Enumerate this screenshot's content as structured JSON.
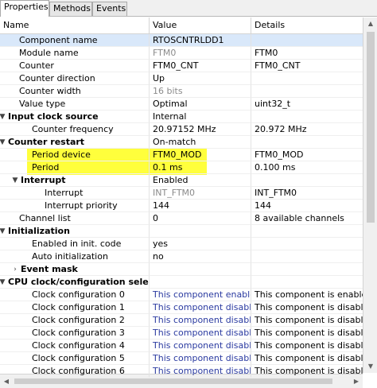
{
  "tabs": [
    {
      "label": "Properties"
    },
    {
      "label": "Methods"
    },
    {
      "label": "Events"
    }
  ],
  "columns": {
    "name": "Name",
    "value": "Value",
    "details": "Details"
  },
  "rows": [
    {
      "name": "Component name",
      "value": "RTOSCNTRLDD1",
      "details": "",
      "bold": false,
      "twisty": ""
    },
    {
      "name": "Module name",
      "value": "FTM0",
      "details": "FTM0",
      "bold": false,
      "twisty": ""
    },
    {
      "name": "Counter",
      "value": "FTM0_CNT",
      "details": "FTM0_CNT",
      "bold": false,
      "twisty": ""
    },
    {
      "name": "Counter direction",
      "value": "Up",
      "details": "",
      "bold": false,
      "twisty": ""
    },
    {
      "name": "Counter width",
      "value": "16 bits",
      "details": "",
      "bold": false,
      "twisty": ""
    },
    {
      "name": "Value type",
      "value": "Optimal",
      "details": "uint32_t",
      "bold": false,
      "twisty": ""
    },
    {
      "name": "Input clock source",
      "value": "Internal",
      "details": "",
      "bold": true,
      "twisty": "▼"
    },
    {
      "name": "Counter frequency",
      "value": "20.97152 MHz",
      "details": "20.972 MHz",
      "bold": false,
      "twisty": ""
    },
    {
      "name": "Counter restart",
      "value": "On-match",
      "details": "",
      "bold": true,
      "twisty": "▼"
    },
    {
      "name": "Period device",
      "value": "FTM0_MOD",
      "details": "FTM0_MOD",
      "bold": false,
      "twisty": ""
    },
    {
      "name": "Period",
      "value": "0.1 ms",
      "details": "0.100 ms",
      "bold": false,
      "twisty": ""
    },
    {
      "name": "Interrupt",
      "value": "Enabled",
      "details": "",
      "bold": true,
      "twisty": "▼"
    },
    {
      "name": "Interrupt",
      "value": "INT_FTM0",
      "details": "INT_FTM0",
      "bold": false,
      "twisty": ""
    },
    {
      "name": "Interrupt priority",
      "value": "144",
      "details": "144",
      "bold": false,
      "twisty": ""
    },
    {
      "name": "Channel list",
      "value": "0",
      "details": "8 available channels",
      "bold": false,
      "twisty": ""
    },
    {
      "name": "Initialization",
      "value": "",
      "details": "",
      "bold": true,
      "twisty": "▼"
    },
    {
      "name": "Enabled in init. code",
      "value": "yes",
      "details": "",
      "bold": false,
      "twisty": ""
    },
    {
      "name": "Auto initialization",
      "value": "no",
      "details": "",
      "bold": false,
      "twisty": ""
    },
    {
      "name": "Event mask",
      "value": "",
      "details": "",
      "bold": true,
      "twisty": "›"
    },
    {
      "name": "CPU clock/configuration selection",
      "value": "",
      "details": "",
      "bold": true,
      "twisty": "▼"
    },
    {
      "name": "Clock configuration 0",
      "value": "This component enabled",
      "details": "This component is enabled",
      "bold": false,
      "twisty": ""
    },
    {
      "name": "Clock configuration 1",
      "value": "This component disabled",
      "details": "This component is disabled",
      "bold": false,
      "twisty": ""
    },
    {
      "name": "Clock configuration 2",
      "value": "This component disabled",
      "details": "This component is disabled",
      "bold": false,
      "twisty": ""
    },
    {
      "name": "Clock configuration 3",
      "value": "This component disabled",
      "details": "This component is disabled",
      "bold": false,
      "twisty": ""
    },
    {
      "name": "Clock configuration 4",
      "value": "This component disabled",
      "details": "This component is disabled",
      "bold": false,
      "twisty": ""
    },
    {
      "name": "Clock configuration 5",
      "value": "This component disabled",
      "details": "This component is disabled",
      "bold": false,
      "twisty": ""
    },
    {
      "name": "Clock configuration 6",
      "value": "This component disabled",
      "details": "This component is disabled",
      "bold": false,
      "twisty": ""
    }
  ],
  "highlight_color": "#ffff3c",
  "selected_row_color": "#d9e8fa"
}
